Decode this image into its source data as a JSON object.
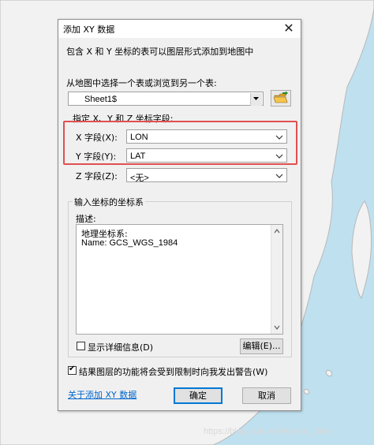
{
  "dialog": {
    "title": "添加 XY 数据",
    "close_glyph": "✕",
    "intro": "包含 X 和 Y 坐标的表可以图层形式添加到地图中",
    "choose_table_label": "从地图中选择一个表或浏览到另一个表:",
    "table_value": "Sheet1$",
    "fields_caption": "指定 X、Y 和 Z 坐标字段:",
    "x_field": {
      "label": "X 字段(X):",
      "value": "LON"
    },
    "y_field": {
      "label": "Y 字段(Y):",
      "value": "LAT"
    },
    "z_field": {
      "label": "Z 字段(Z):",
      "value": "<无>"
    },
    "crs_caption": "输入坐标的坐标系",
    "description_label": "描述:",
    "description_line1": "地理坐标系:",
    "description_line2": "Name: GCS_WGS_1984",
    "show_details_label": "显示详细信息(D)",
    "show_details_checked": false,
    "edit_button": "编辑(E)...",
    "warning_label": "结果图层的功能将会受到限制时向我发出警告(W)",
    "warning_checked": true,
    "about_link": "关于添加 XY 数据",
    "ok_button": "确定",
    "cancel_button": "取消"
  },
  "watermark": "https://blog.csdn.net/Kyson_Joke",
  "colors": {
    "sea": "#bfe0ef",
    "land": "#f2f2f2",
    "highlight": "#e05050",
    "link": "#0066cc"
  }
}
